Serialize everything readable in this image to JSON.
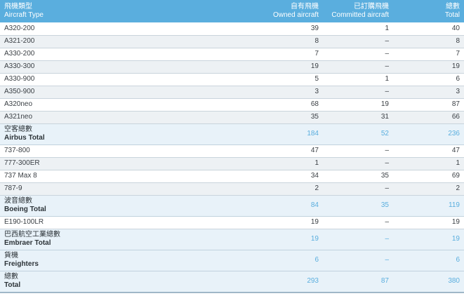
{
  "header": {
    "type_zh": "飛機類型",
    "type_en": "Aircraft Type",
    "owned_zh": "自有飛機",
    "owned_en": "Owned aircraft",
    "committed_zh": "已訂購飛機",
    "committed_en": "Committed aircraft",
    "total_zh": "總數",
    "total_en": "Total"
  },
  "rows": [
    {
      "kind": "item",
      "type": "A320-200",
      "owned": "39",
      "committed": "1",
      "total": "40"
    },
    {
      "kind": "item",
      "type": "A321-200",
      "owned": "8",
      "committed": "–",
      "total": "8"
    },
    {
      "kind": "item",
      "type": "A330-200",
      "owned": "7",
      "committed": "–",
      "total": "7"
    },
    {
      "kind": "item",
      "type": "A330-300",
      "owned": "19",
      "committed": "–",
      "total": "19"
    },
    {
      "kind": "item",
      "type": "A330-900",
      "owned": "5",
      "committed": "1",
      "total": "6"
    },
    {
      "kind": "item",
      "type": "A350-900",
      "owned": "3",
      "committed": "–",
      "total": "3"
    },
    {
      "kind": "item",
      "type": "A320neo",
      "owned": "68",
      "committed": "19",
      "total": "87"
    },
    {
      "kind": "item",
      "type": "A321neo",
      "owned": "35",
      "committed": "31",
      "total": "66"
    },
    {
      "kind": "total",
      "zh": "空客總數",
      "en": "Airbus Total",
      "owned": "184",
      "committed": "52",
      "total": "236"
    },
    {
      "kind": "item",
      "type": "737-800",
      "owned": "47",
      "committed": "–",
      "total": "47"
    },
    {
      "kind": "item",
      "type": "777-300ER",
      "owned": "1",
      "committed": "–",
      "total": "1"
    },
    {
      "kind": "item",
      "type": "737 Max 8",
      "owned": "34",
      "committed": "35",
      "total": "69"
    },
    {
      "kind": "item",
      "type": "787-9",
      "owned": "2",
      "committed": "–",
      "total": "2"
    },
    {
      "kind": "total",
      "zh": "波音總數",
      "en": "Boeing Total",
      "owned": "84",
      "committed": "35",
      "total": "119"
    },
    {
      "kind": "item",
      "type": "E190-100LR",
      "owned": "19",
      "committed": "–",
      "total": "19"
    },
    {
      "kind": "total",
      "zh": "巴西航空工業總數",
      "en": "Embraer Total",
      "owned": "19",
      "committed": "–",
      "total": "19"
    },
    {
      "kind": "total",
      "zh": "貨機",
      "en": "Freighters",
      "owned": "6",
      "committed": "–",
      "total": "6"
    },
    {
      "kind": "total",
      "zh": "總數",
      "en": "Total",
      "owned": "293",
      "committed": "87",
      "total": "380",
      "grand": true
    }
  ]
}
